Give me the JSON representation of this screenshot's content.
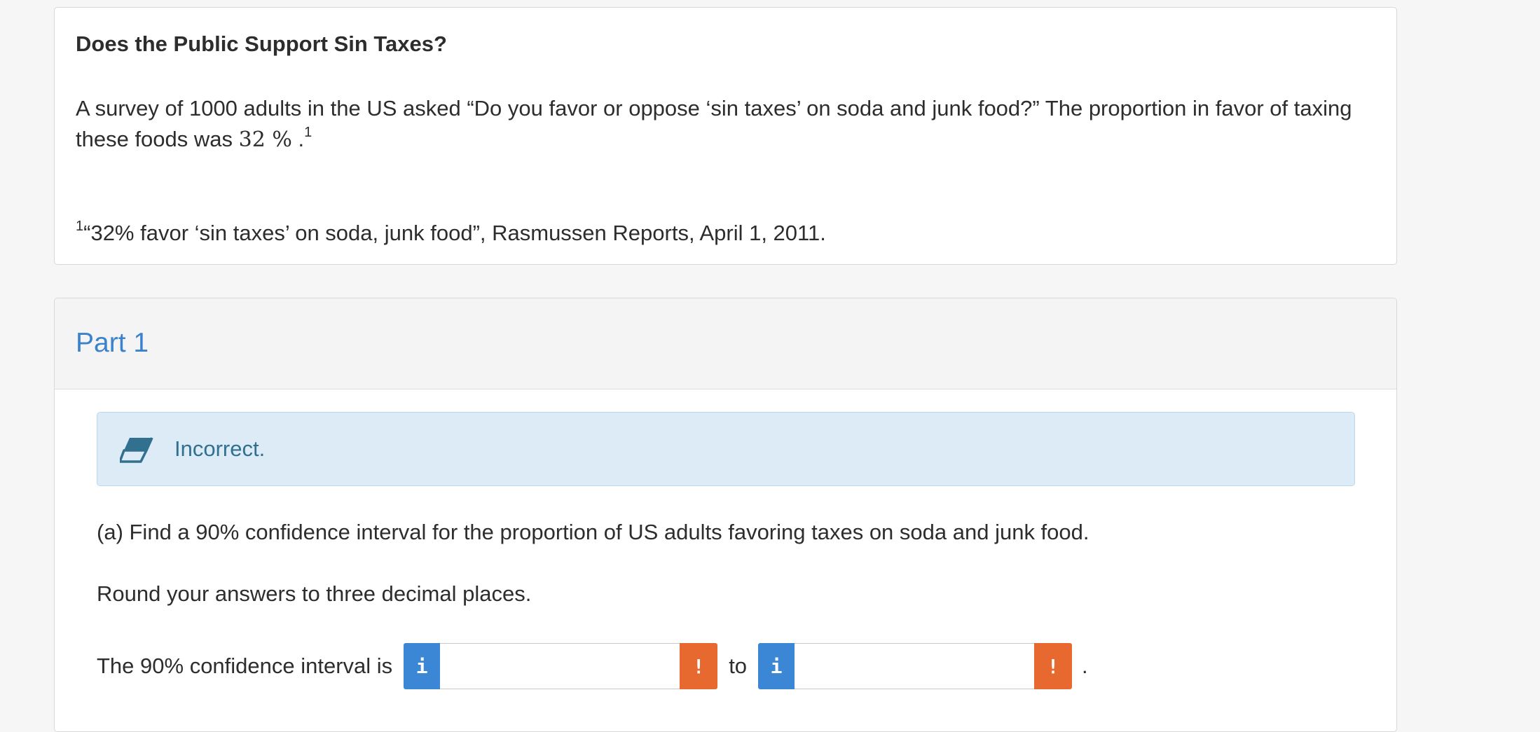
{
  "problem": {
    "title": "Does the Public Support Sin Taxes?",
    "text_before": "A survey of 1000 adults in the US asked “Do you favor or oppose ‘sin taxes’ on soda and junk food?” The proportion in favor of taxing these foods was",
    "value": "32 %",
    "text_after": ".",
    "footnote_marker": "1",
    "footnote_text": "“32% favor ‘sin taxes’ on soda, junk food”, Rasmussen Reports, April 1, 2011."
  },
  "part": {
    "title": "Part 1",
    "alert": {
      "icon": "eraser-icon",
      "text": "Incorrect."
    },
    "question": "(a) Find a 90% confidence interval for the proportion of US adults favoring taxes on soda and junk food.",
    "instruction": "Round your answers to three decimal places.",
    "answer": {
      "label": "The 90% confidence interval is",
      "info_icon_glyph": "i",
      "warn_icon_glyph": "!",
      "lower_value": "",
      "upper_value": "",
      "connector": "to",
      "end": "."
    }
  },
  "colors": {
    "link_blue": "#3b82cc",
    "info_button": "#3b87d6",
    "warn_button": "#e8692f",
    "alert_bg": "#ddebf7",
    "alert_text": "#31708f"
  }
}
